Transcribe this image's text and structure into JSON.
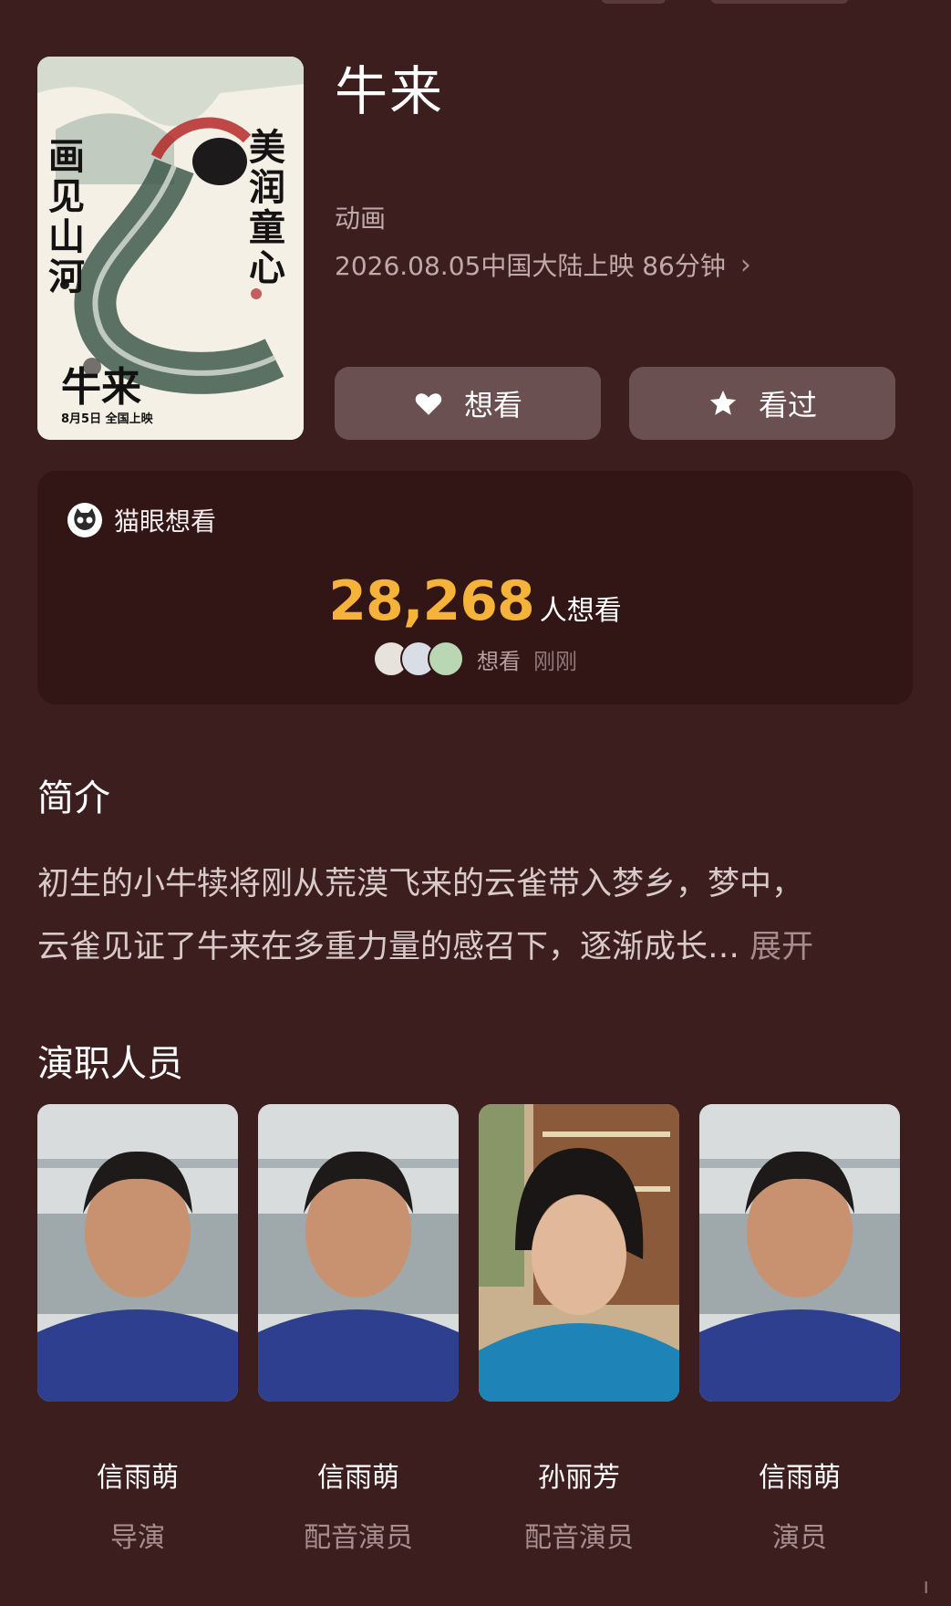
{
  "movie": {
    "title": "牛来",
    "genre": "动画",
    "release_info": "2026.08.05中国大陆上映 86分钟",
    "poster": {
      "title_text": "牛来",
      "slogan_left": "画见山河",
      "slogan_right": "美润童心",
      "date_text": "8月5日 全国上映"
    }
  },
  "actions": {
    "want_label": "想看",
    "seen_label": "看过"
  },
  "maoyan": {
    "source_label": "猫眼想看",
    "count": "28,268",
    "count_unit": "人想看",
    "recent_action": "想看",
    "recent_time": "刚刚"
  },
  "synopsis": {
    "heading": "简介",
    "line1": "初生的小牛犊将刚从荒漠飞来的云雀带入梦乡，梦中，",
    "line2": "云雀见证了牛来在多重力量的感召下，逐渐成长…",
    "expand_label": "展开"
  },
  "cast": {
    "heading": "演职人员",
    "members": [
      {
        "name": "信雨萌",
        "role": "导演"
      },
      {
        "name": "信雨萌",
        "role": "配音演员"
      },
      {
        "name": "孙丽芳",
        "role": "配音演员"
      },
      {
        "name": "信雨萌",
        "role": "演员"
      }
    ]
  },
  "colors": {
    "background": "#3d1e1e",
    "card": "#321616",
    "button": "#6b5051",
    "count": "#f5b33a"
  },
  "icons": {
    "want": "heart-icon",
    "seen": "star-icon",
    "release_more": "chevron-right-icon",
    "source": "cat-logo-icon"
  }
}
